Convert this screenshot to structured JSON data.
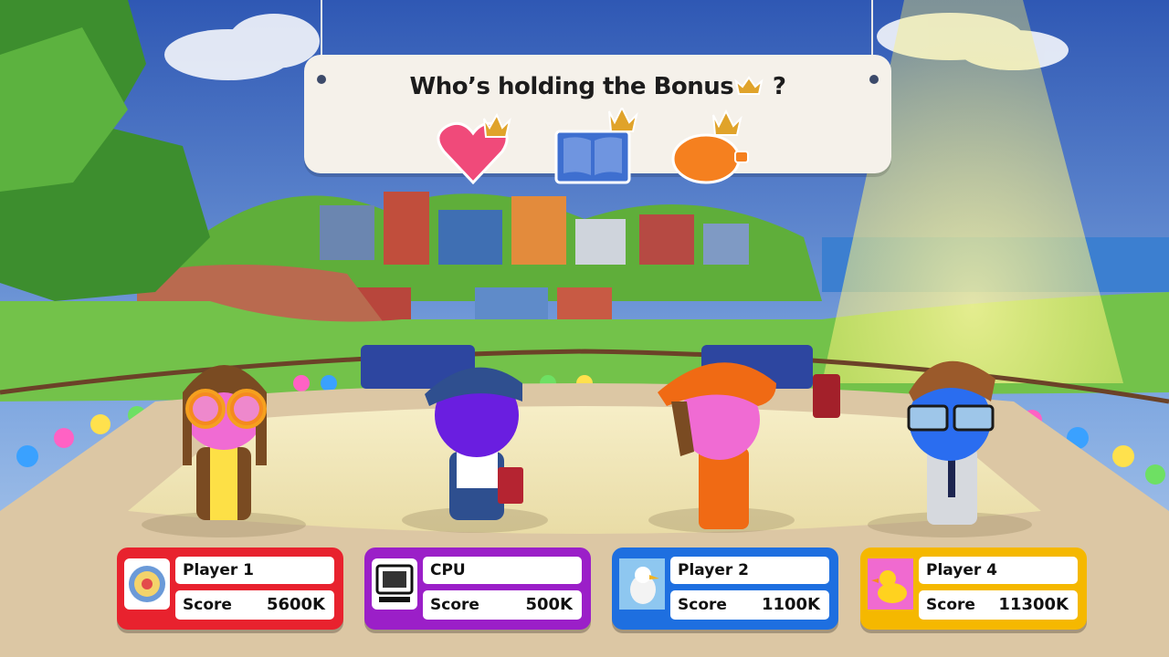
{
  "banner": {
    "title": "Who’s holding the Bonus",
    "title_suffix": "?",
    "bonus_icons": [
      "heart-icon",
      "book-icon",
      "piggy-bank-icon"
    ]
  },
  "players": [
    {
      "name": "Player 1",
      "score_label": "Score",
      "score": "5600K",
      "color": "#e8222e",
      "avatar": "wheel-of-fortune-icon"
    },
    {
      "name": "CPU",
      "score_label": "Score",
      "score": "500K",
      "color": "#9b1fc8",
      "avatar": "computer-icon"
    },
    {
      "name": "Player 2",
      "score_label": "Score",
      "score": "1100K",
      "color": "#1e6fe0",
      "avatar": "seagull-icon"
    },
    {
      "name": "Player 4",
      "score_label": "Score",
      "score": "11300K",
      "color": "#f5b800",
      "avatar": "rubber-duck-icon"
    }
  ],
  "colors": {
    "banner_bg": "#f5f1ea",
    "crown": "#e0a32a",
    "stage": "#f4e9b8",
    "sky": "#4a78c8"
  }
}
